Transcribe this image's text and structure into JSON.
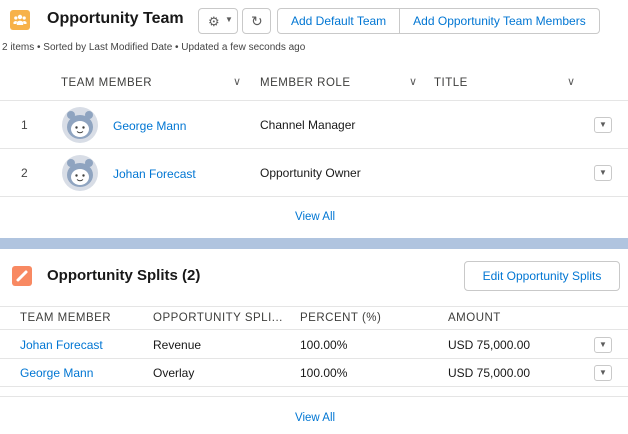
{
  "team": {
    "title": "Opportunity Team",
    "buttons": {
      "add_default": "Add Default Team",
      "add_members": "Add Opportunity Team Members"
    },
    "meta": "2 items • Sorted by Last Modified Date • Updated a few seconds ago",
    "columns": {
      "member": "TEAM MEMBER",
      "role": "MEMBER ROLE",
      "title": "TITLE"
    },
    "rows": [
      {
        "num": "1",
        "name": "George Mann",
        "role": "Channel Manager",
        "title": ""
      },
      {
        "num": "2",
        "name": "Johan Forecast",
        "role": "Opportunity Owner",
        "title": ""
      }
    ],
    "view_all": "View All"
  },
  "splits": {
    "title": "Opportunity Splits (2)",
    "edit_button": "Edit Opportunity Splits",
    "columns": {
      "member": "TEAM MEMBER",
      "split": "OPPORTUNITY SPLI...",
      "percent": "PERCENT (%)",
      "amount": "AMOUNT"
    },
    "rows": [
      {
        "member": "Johan Forecast",
        "split": "Revenue",
        "percent": "100.00%",
        "amount": "USD 75,000.00"
      },
      {
        "member": "George Mann",
        "split": "Overlay",
        "percent": "100.00%",
        "amount": "USD 75,000.00"
      }
    ],
    "view_all": "View All"
  },
  "icons": {
    "team": "opportunity-team-icon",
    "splits": "opportunity-splits-icon",
    "gear": "gear-icon",
    "refresh": "refresh-icon",
    "chevron": "chevron-down-icon",
    "row_action": "row-action-caret-icon",
    "avatar": "default-user-avatar"
  },
  "colors": {
    "link": "#0176d3",
    "team_icon": "#f7b24a",
    "splits_icon": "#f88962",
    "divider": "#b0c4df"
  }
}
